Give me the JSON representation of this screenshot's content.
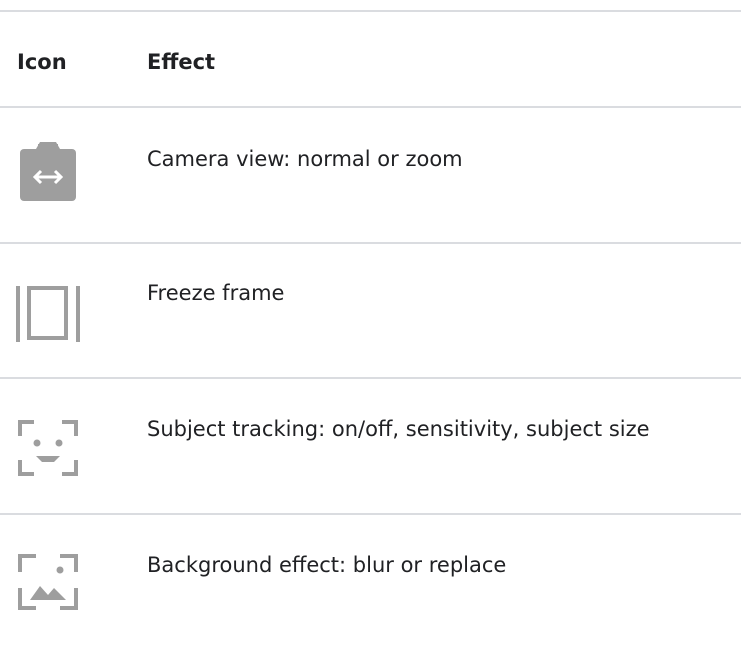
{
  "table": {
    "headers": {
      "icon": "Icon",
      "effect": "Effect"
    },
    "rows": [
      {
        "icon": "camera-view-icon",
        "effect": "Camera view: normal or zoom"
      },
      {
        "icon": "freeze-frame-icon",
        "effect": "Freeze frame"
      },
      {
        "icon": "subject-tracking-icon",
        "effect": "Subject tracking: on/off, sensitivity, subject size"
      },
      {
        "icon": "background-effect-icon",
        "effect": "Background effect: blur or replace"
      }
    ]
  },
  "colors": {
    "icon_gray": "#9e9e9e",
    "divider": "#dadce0",
    "text": "#202124"
  }
}
